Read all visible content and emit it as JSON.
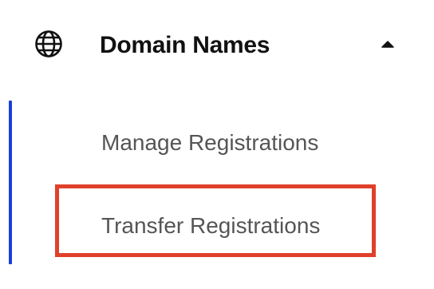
{
  "nav": {
    "section": {
      "title": "Domain Names",
      "icon": "globe-icon",
      "toggle_icon": "caret-up-icon",
      "expanded": true
    },
    "items": [
      {
        "label": "Manage Registrations"
      },
      {
        "label": "Transfer Registrations"
      }
    ]
  },
  "colors": {
    "active_indicator": "#1b3fd6",
    "highlight_border": "#e0402a",
    "title_text": "#111111",
    "item_text": "#555555"
  }
}
